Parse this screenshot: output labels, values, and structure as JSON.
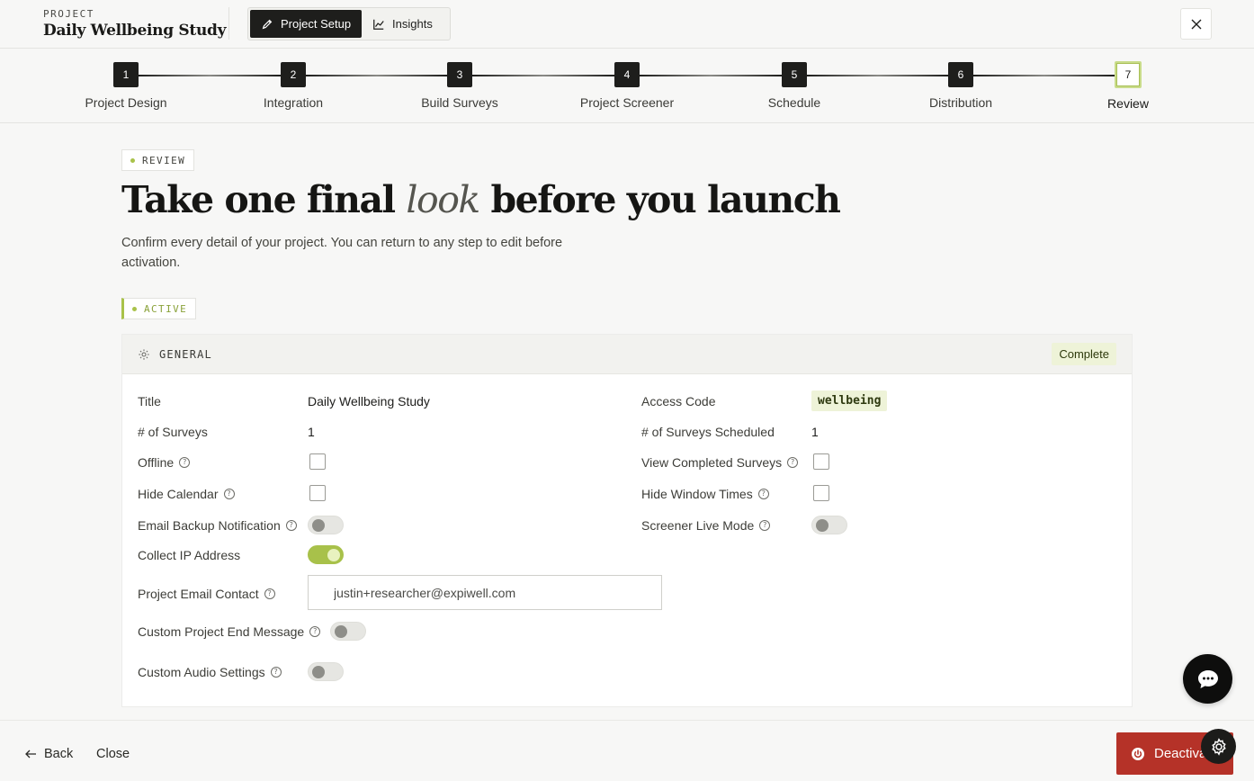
{
  "header": {
    "kicker": "PROJECT",
    "project_title": "Daily Wellbeing Study",
    "tabs": [
      {
        "label": "Project Setup",
        "icon": "pencil-icon",
        "active": true
      },
      {
        "label": "Insights",
        "icon": "line-chart-icon",
        "active": false
      }
    ],
    "close_icon": "close-icon"
  },
  "stepper": {
    "steps": [
      {
        "num": "1",
        "label": "Project Design"
      },
      {
        "num": "2",
        "label": "Integration"
      },
      {
        "num": "3",
        "label": "Build Surveys"
      },
      {
        "num": "4",
        "label": "Project Screener"
      },
      {
        "num": "5",
        "label": "Schedule"
      },
      {
        "num": "6",
        "label": "Distribution"
      },
      {
        "num": "7",
        "label": "Review"
      }
    ],
    "current_step": 7
  },
  "main": {
    "review_tag": "REVIEW",
    "headline_part1": "Take one final",
    "headline_italic": "look",
    "headline_part2": "before you launch",
    "subtext": "Confirm every detail of your project. You can return to any step to edit before activation.",
    "active_tag": "ACTIVE"
  },
  "general": {
    "title": "GENERAL",
    "status": "Complete",
    "fields": {
      "title_label": "Title",
      "title_value": "Daily Wellbeing Study",
      "surveys_label": "# of Surveys",
      "surveys_value": "1",
      "offline_label": "Offline",
      "offline_checked": false,
      "hide_calendar_label": "Hide Calendar",
      "hide_calendar_checked": false,
      "email_backup_label": "Email Backup Notification",
      "email_backup_on": false,
      "collect_ip_label": "Collect IP Address",
      "collect_ip_on": true,
      "email_contact_label": "Project Email Contact",
      "email_contact_value": "justin+researcher@expiwell.com",
      "custom_end_label": "Custom Project End Message",
      "custom_end_on": false,
      "custom_audio_label": "Custom Audio Settings",
      "custom_audio_on": false,
      "access_code_label": "Access Code",
      "access_code_value": "wellbeing",
      "surveys_scheduled_label": "# of Surveys Scheduled",
      "surveys_scheduled_value": "1",
      "view_completed_label": "View Completed Surveys",
      "view_completed_checked": false,
      "hide_window_label": "Hide Window Times",
      "hide_window_checked": false,
      "screener_live_label": "Screener Live Mode",
      "screener_live_on": false
    },
    "help_glyph": "?"
  },
  "footer": {
    "back_label": "Back",
    "close_label": "Close",
    "deactivate_label": "Deactivate"
  },
  "colors": {
    "accent_green": "#a9c24a",
    "danger_red": "#b53228",
    "dark": "#1e1e1c"
  }
}
